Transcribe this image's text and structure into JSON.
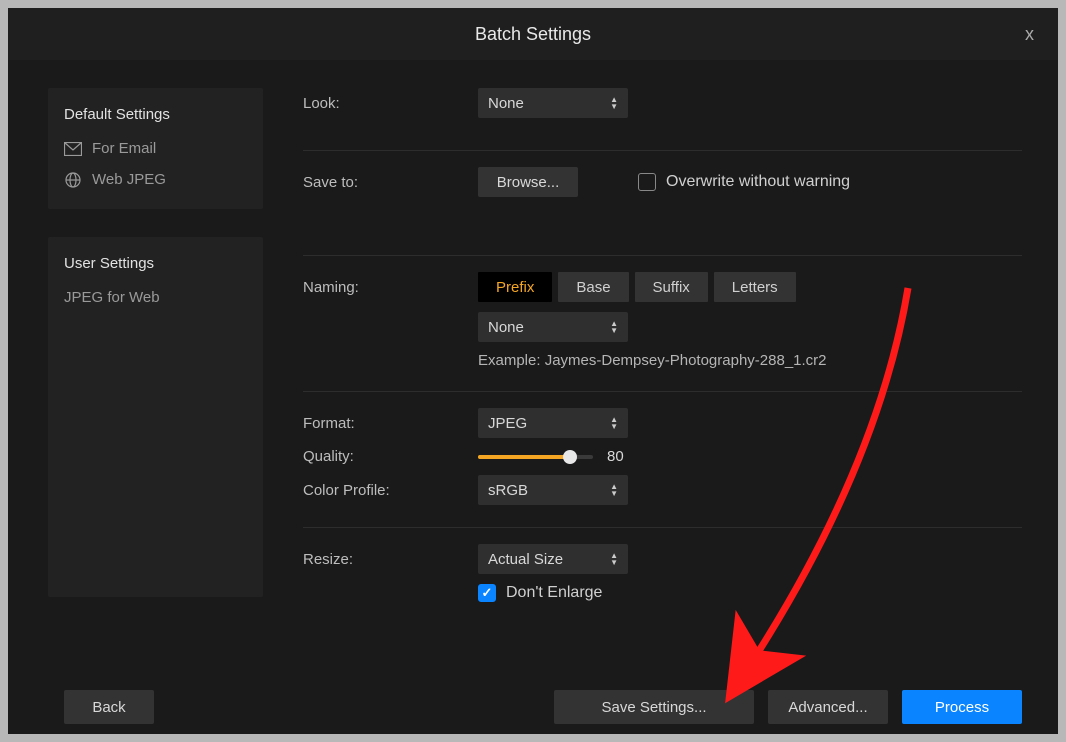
{
  "title": "Batch Settings",
  "sidebar": {
    "default_header": "Default Settings",
    "items_default": [
      {
        "icon": "mail-icon",
        "label": "For Email"
      },
      {
        "icon": "globe-icon",
        "label": "Web JPEG"
      }
    ],
    "user_header": "User Settings",
    "items_user": [
      {
        "label": "JPEG for Web"
      }
    ]
  },
  "look": {
    "label": "Look:",
    "value": "None"
  },
  "save_to": {
    "label": "Save to:",
    "browse": "Browse...",
    "overwrite_label": "Overwrite without warning",
    "overwrite_checked": false
  },
  "naming": {
    "label": "Naming:",
    "segments": [
      "Prefix",
      "Base",
      "Suffix",
      "Letters"
    ],
    "active": "Prefix",
    "value": "None",
    "example_label": "Example:",
    "example_value": "Jaymes-Dempsey-Photography-288_1.cr2"
  },
  "format": {
    "label": "Format:",
    "value": "JPEG"
  },
  "quality": {
    "label": "Quality:",
    "value": 80,
    "min": 0,
    "max": 100
  },
  "color_profile": {
    "label": "Color Profile:",
    "value": "sRGB"
  },
  "resize": {
    "label": "Resize:",
    "value": "Actual Size",
    "dont_enlarge_label": "Don't Enlarge",
    "dont_enlarge_checked": true
  },
  "footer": {
    "back": "Back",
    "save_settings": "Save Settings...",
    "advanced": "Advanced...",
    "process": "Process"
  }
}
